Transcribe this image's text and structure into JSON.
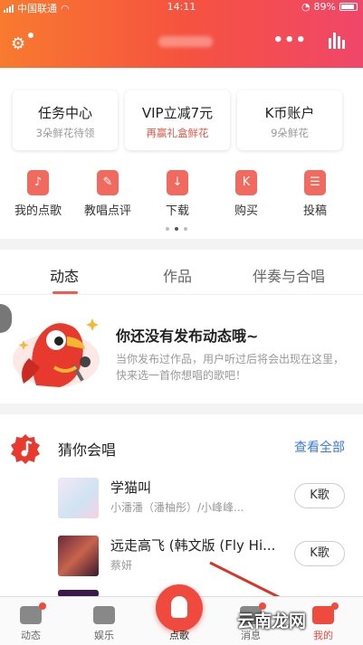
{
  "status_bar": {
    "carrier": "中国联通",
    "time": "14:11",
    "battery": "89%"
  },
  "header": {
    "more_label": "•••"
  },
  "cards": [
    {
      "title": "任务中心",
      "subtitle": "3朵鲜花待领"
    },
    {
      "title": "VIP立减7元",
      "subtitle": "再赢礼盒鲜花"
    },
    {
      "title": "K币账户",
      "subtitle": "9朵鲜花"
    }
  ],
  "quick_actions": [
    {
      "label": "我的点歌",
      "icon": "mic-icon"
    },
    {
      "label": "教唱点评",
      "icon": "pen-icon"
    },
    {
      "label": "下载",
      "icon": "download-icon"
    },
    {
      "label": "购买",
      "icon": "cart-icon"
    },
    {
      "label": "投稿",
      "icon": "submit-icon"
    }
  ],
  "tabs": [
    "动态",
    "作品",
    "伴奏与合唱"
  ],
  "active_tab": "动态",
  "empty_state": {
    "title": "你还没有发布动态哦~",
    "description": "当你发布过作品，用户听过后将会出现在这里，快来选一首你想唱的歌吧！"
  },
  "guess": {
    "title": "猜你会唱",
    "see_all": "查看全部"
  },
  "songs": [
    {
      "title": "学猫叫",
      "artist": "小潘潘（潘柚彤）/小峰峰...",
      "button": "K歌"
    },
    {
      "title": "远走高飞 (韩文版 (Fly Hi...",
      "artist": "蔡妍",
      "button": "K歌"
    }
  ],
  "bottom_nav": [
    {
      "label": "动态",
      "icon": "feed-icon"
    },
    {
      "label": "娱乐",
      "icon": "people-icon"
    },
    {
      "label": "点歌",
      "icon": "mic-icon"
    },
    {
      "label": "消息",
      "icon": "message-icon"
    },
    {
      "label": "我的",
      "icon": "profile-icon"
    }
  ],
  "watermark": "云南龙网",
  "colors": {
    "brand_red": "#f04a3f",
    "header_gradient_start": "#f87a2f",
    "header_gradient_end": "#f0466a",
    "link_blue": "#3b7ad8"
  }
}
